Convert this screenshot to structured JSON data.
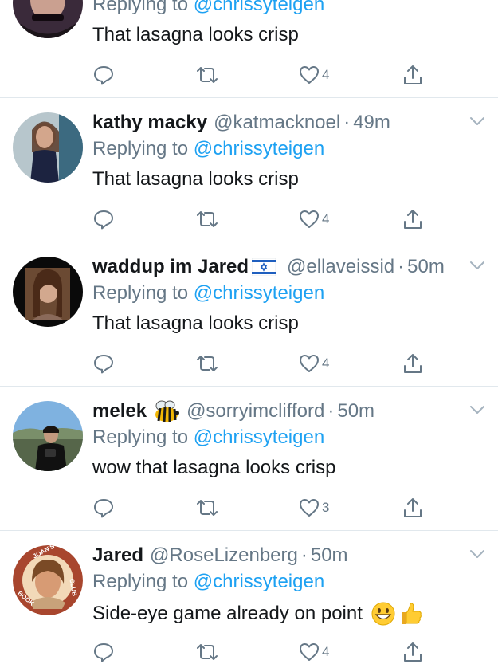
{
  "colors": {
    "text": "#14171a",
    "muted": "#657786",
    "accent": "#1da1f2",
    "divider": "#e1e8ed"
  },
  "tweets": [
    {
      "name": "",
      "handle": "",
      "time": "",
      "replying_prefix": "Replying to ",
      "replying_to": "@chrissyteigen",
      "text": "That lasagna looks crisp",
      "likes": "4"
    },
    {
      "name": "kathy macky",
      "handle": "@katmacknoel",
      "time": "49m",
      "replying_prefix": "Replying to ",
      "replying_to": "@chrissyteigen",
      "text": "That lasagna looks crisp",
      "likes": "4"
    },
    {
      "name": "waddup im Jared",
      "name_emoji": "israel-flag-icon",
      "handle": "@ellaveissid",
      "time": "50m",
      "replying_prefix": "Replying to ",
      "replying_to": "@chrissyteigen",
      "text": "That lasagna looks crisp",
      "likes": "4"
    },
    {
      "name": "melek",
      "name_emoji": "bee-icon",
      "handle": "@sorryimclifford",
      "time": "50m",
      "replying_prefix": "Replying to ",
      "replying_to": "@chrissyteigen",
      "text": "wow that lasagna looks crisp",
      "likes": "3"
    },
    {
      "name": "Jared",
      "handle": "@RoseLizenberg",
      "time": "50m",
      "replying_prefix": "Replying to ",
      "replying_to": "@chrissyteigen",
      "text": "Side-eye game already on point",
      "text_emojis": [
        "grinning-face-icon",
        "thumbs-up-icon"
      ],
      "likes": "4",
      "avatar_badge": {
        "top": "JOAN'S",
        "left": "BOOK",
        "right": "CLUB"
      }
    }
  ],
  "dot": "·"
}
